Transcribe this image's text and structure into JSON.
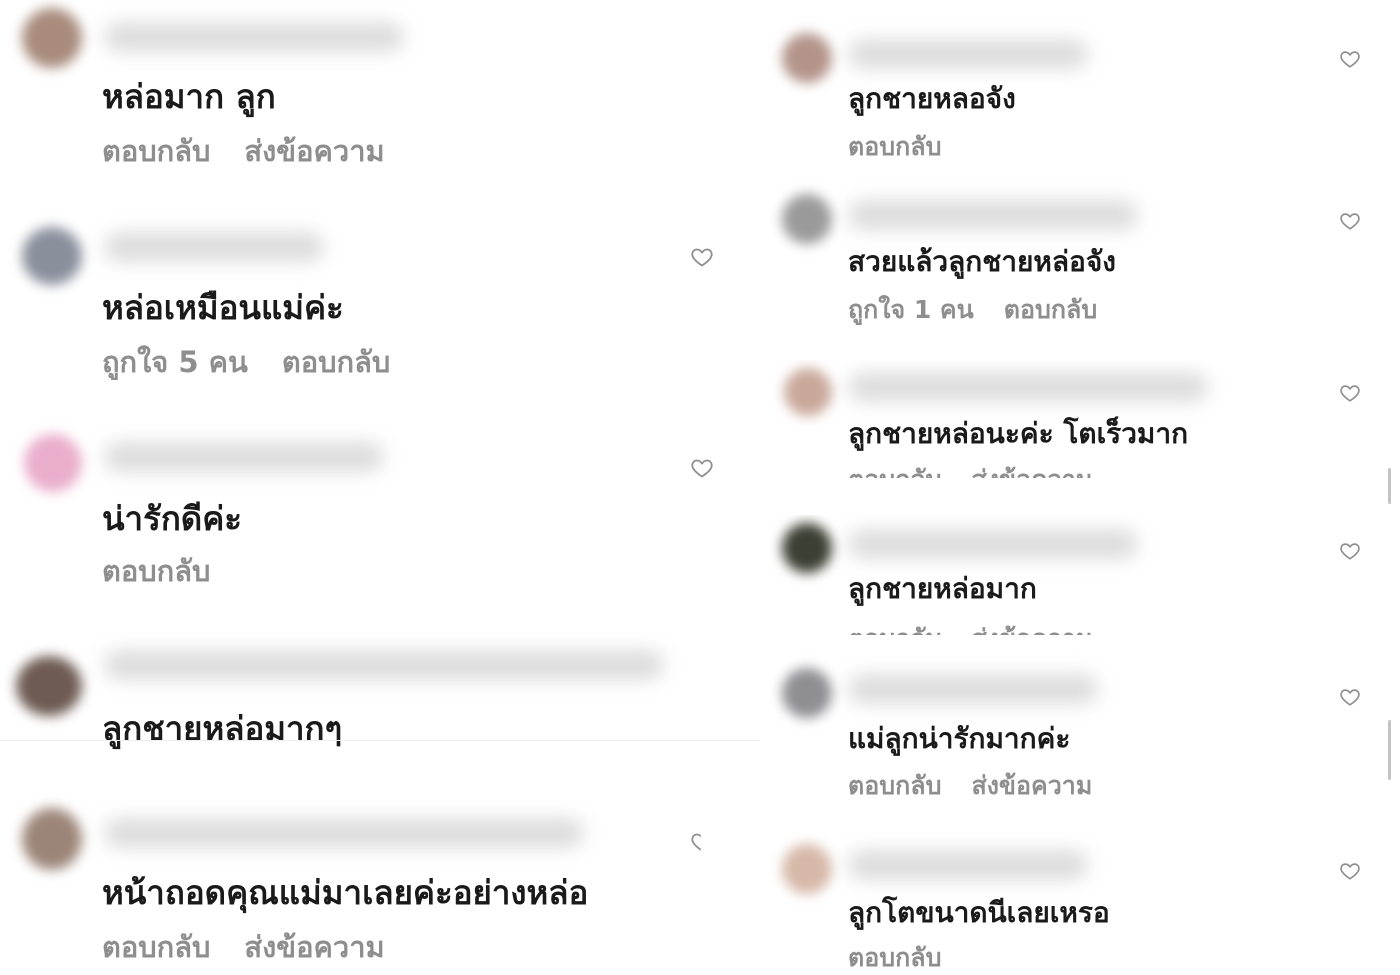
{
  "left": {
    "comments": [
      {
        "text": "หล่อมาก ลูก",
        "actions": [
          "ตอบกลับ",
          "ส่งข้อความ"
        ],
        "avatar_color": "#a88b7c",
        "heart": false
      },
      {
        "text": "หล่อเหมือนแม่ค่ะ",
        "actions": [
          "ถูกใจ 5 คน",
          "ตอบกลับ"
        ],
        "avatar_color": "#8a8f9c",
        "heart": true
      },
      {
        "text": "น่ารักดีค่ะ",
        "actions": [
          "ตอบกลับ"
        ],
        "avatar_color": "#eaaecb",
        "heart": true
      },
      {
        "text": "ลูกชายหล่อมากๆ",
        "actions": [],
        "avatar_color": "#6e5b53",
        "heart": false
      },
      {
        "text": "หน้าถอดคุณแม่มาเลยค่ะอย่างหล่อ",
        "actions": [
          "ตอบกลับ",
          "ส่งข้อความ"
        ],
        "avatar_color": "#9c8578",
        "heart": true
      }
    ]
  },
  "right": {
    "comments": [
      {
        "text": "ลูกชายหลอจัง",
        "actions": [
          "ตอบกลับ"
        ],
        "avatar_color": "#b3948a",
        "heart": true
      },
      {
        "text": "สวยแล้วลูกชายหล่อจัง",
        "actions": [
          "ถูกใจ 1 คน",
          "ตอบกลับ"
        ],
        "avatar_color": "#9a9a9a",
        "heart": true
      },
      {
        "text": "ลูกชายหล่อนะค่ะ โตเร็วมาก",
        "actions": [
          "ตอบกลับ",
          "ส่งข้อความ"
        ],
        "avatar_color": "#c9a89a",
        "heart": true
      },
      {
        "text": "ลูกชายหล่อมาก",
        "actions": [
          "ตอบกลับ",
          "ส่งข้อความ"
        ],
        "avatar_color": "#3c3f33",
        "heart": true
      },
      {
        "text": "แม่ลูกน่ารักมากค่ะ",
        "actions": [
          "ตอบกลับ",
          "ส่งข้อความ"
        ],
        "avatar_color": "#8e8e93",
        "heart": true
      },
      {
        "text": "ลูกโตขนาดนีเลยเหรอ",
        "actions": [
          "ตอบกลับ"
        ],
        "avatar_color": "#d6b8a8",
        "heart": true
      }
    ]
  },
  "colors": {
    "text": "#1a1a1a",
    "meta": "#8e8e8e",
    "heart": "#8e8e8e"
  },
  "icons": {
    "heart": "heart-outline-icon"
  }
}
